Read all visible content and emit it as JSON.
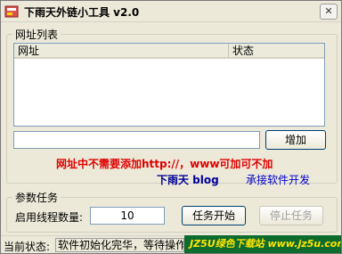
{
  "window": {
    "title": "下雨天外链小工具 v2.0",
    "close_label": "✕"
  },
  "list_group": {
    "legend": "网址列表",
    "columns": [
      "网址",
      "状态"
    ],
    "url_input": {
      "value": "",
      "placeholder": ""
    },
    "add_button": "增加",
    "notice": "网址中不需要添加http://，www可加可不加",
    "author": "下雨天 blog",
    "service": "承接软件开发"
  },
  "params_group": {
    "legend": "参数任务",
    "thread_label": "启用线程数量:",
    "thread_value": "10",
    "start_button": "任务开始",
    "stop_button": "停止任务"
  },
  "statusbar": {
    "label": "当前状态:",
    "value": "软件初始化完华，等待操作",
    "watermark": "JZ5U绿色下载站 www.jz5u.com"
  },
  "colors": {
    "notice": "#e00000",
    "author": "#000099",
    "service": "#0000cc",
    "watermark_bg": "#0e6b2e",
    "watermark_text": "#ffe600"
  },
  "icons": {
    "app": "app-icon",
    "close": "close-icon"
  }
}
